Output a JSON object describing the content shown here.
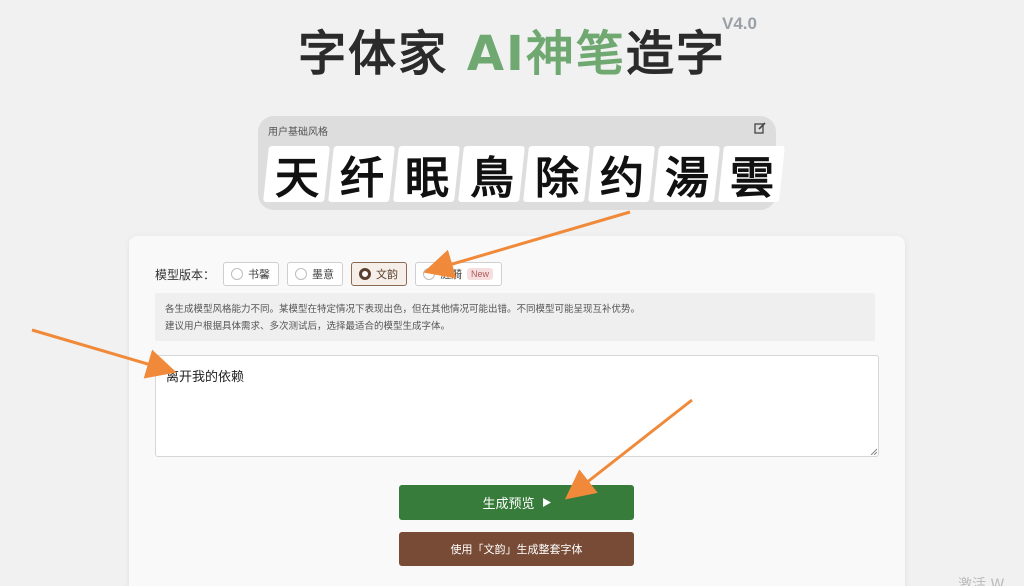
{
  "header": {
    "title_pre": "字体家 ",
    "title_accent": "AI神笔",
    "title_post": "造字",
    "version": "V4.0"
  },
  "base_style": {
    "label": "用户基础风格",
    "glyphs": [
      "天",
      "纤",
      "眠",
      "鳥",
      "除",
      "约",
      "湯",
      "雲"
    ]
  },
  "model": {
    "label": "模型版本：",
    "options": [
      {
        "label": "书馨",
        "selected": false
      },
      {
        "label": "墨意",
        "selected": false
      },
      {
        "label": "文韵",
        "selected": true
      },
      {
        "label": "涟漪",
        "selected": false,
        "badge": "New"
      }
    ]
  },
  "notice": {
    "line1": "各生成模型风格能力不同。某模型在特定情况下表现出色，但在其他情况可能出错。不同模型可能呈现互补优势。",
    "line2": "建议用户根据具体需求、多次测试后，选择最适合的模型生成字体。"
  },
  "input": {
    "value": "离开我的依赖"
  },
  "buttons": {
    "preview_label": "生成预览",
    "full_label": "使用「文韵」生成整套字体"
  },
  "watermark": "激活 W",
  "colors": {
    "accent_green": "#6fa971",
    "preview_button": "#377c3a",
    "full_button": "#774b35",
    "annotation_arrow": "#f08a3a"
  },
  "icons": {
    "edit": "edit-icon",
    "play": "play-icon"
  }
}
